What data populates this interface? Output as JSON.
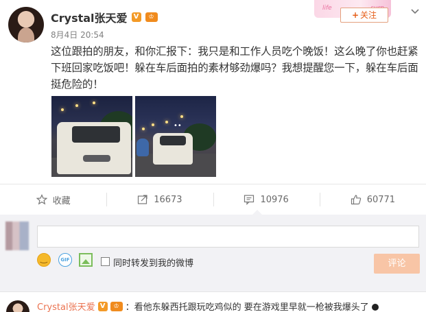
{
  "post": {
    "username": "Crystal张天爱",
    "vip_badge": "V",
    "crown_badge": "♔",
    "timestamp": "8月4日 20:54",
    "text": "这位跟拍的朋友，和你汇报下：我只是和工作人员吃个晚饭！这么晚了你也赶紧下班回家吃饭吧！躲在车后面拍的素材够劲爆吗？我想提醒您一下，躲在车后面挺危险的！",
    "follow_label": "关注",
    "banner_left": "life",
    "banner_right": "surp",
    "photo2_overlay": "••"
  },
  "actions": {
    "favorite_label": "收藏",
    "repost_count": "16673",
    "comment_count": "10976",
    "like_count": "60771"
  },
  "composer": {
    "input_value": "",
    "gif_label": "GIF",
    "repost_checkbox_label": "同时转发到我的微博",
    "submit_label": "评论"
  },
  "comment": {
    "name": "Crystal张天爱",
    "vip_badge": "V",
    "crown_badge": "♔",
    "text": "：看他东躲西托跟玩吃鸡似的 要在游戏里早就一枪被我爆头了"
  },
  "colors": {
    "accent": "#eb7350",
    "follow": "#e65e18",
    "submit_bg": "#f8c5a6",
    "vip": "#f39a27"
  }
}
